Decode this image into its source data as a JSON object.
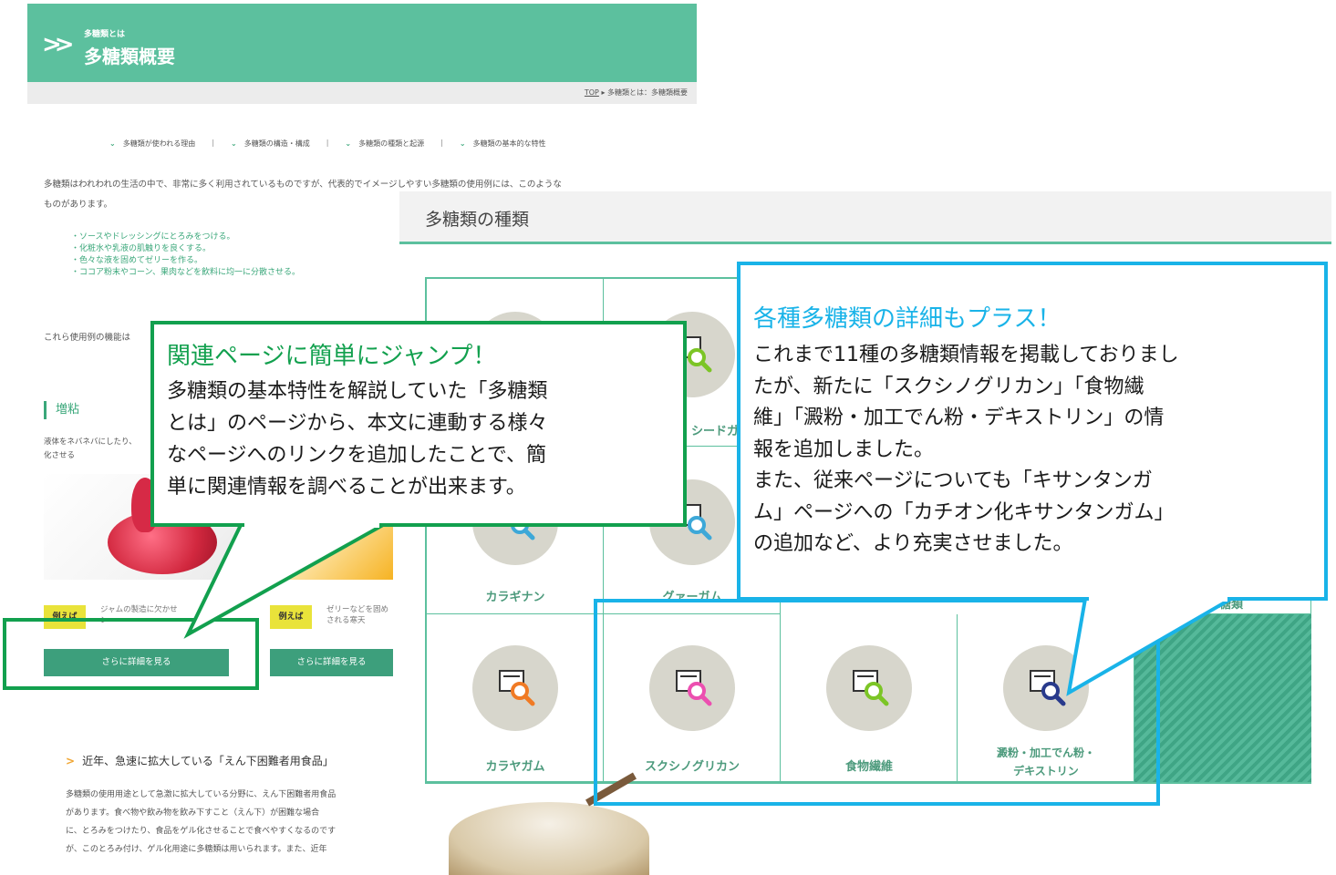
{
  "left_page": {
    "hero": {
      "subtitle": "多糖類とは",
      "title": "多糖類概要"
    },
    "breadcrumb": {
      "top": "TOP",
      "separator": "▸",
      "current": "多糖類とは：多糖類概要"
    },
    "anchors": [
      "多糖類が使われる理由",
      "多糖類の構造・構成",
      "多糖類の種類と起源",
      "多糖類の基本的な特性"
    ],
    "intro_lines": [
      "多糖類はわれわれの生活の中で、非常に多く利用されているものですが、代表的でイメージしやすい多糖類の使用例には、このような",
      "ものがあります。"
    ],
    "uses": [
      "・ソースやドレッシングにとろみをつける。",
      "・化粧水や乳液の肌触りを良くする。",
      "・色々な液を固めてゼリーを作る。",
      "・ココア粉末やコーン、果肉などを飲料に均一に分散させる。"
    ],
    "tail_text": "これら使用例の機能は",
    "section": {
      "heading": "増粘",
      "desc_lines": [
        "液体をネバネバにしたり、",
        "化させる"
      ]
    },
    "examples": [
      {
        "badge": "例えば",
        "text_lines": [
          "ジャムの製造に欠かせ",
          "ン"
        ],
        "button": "さらに詳細を見る"
      },
      {
        "badge": "例えば",
        "text_lines": [
          "ゼリーなどを固め",
          "される寒天"
        ],
        "button": "さらに詳細を見る"
      }
    ],
    "subsection": {
      "heading": "近年、急速に拡大している「えん下困難者用食品」",
      "lines": [
        "多糖類の使用用途として急激に拡大している分野に、えん下困難者用食品",
        "があります。食べ物や飲み物を飲み下すこと（えん下）が困難な場合",
        "に、とろみをつけたり、食品をゲル化させることで食べやすくなるのです",
        "が、このとろみ付け、ゲル化用途に多糖類は用いられます。また、近年"
      ]
    }
  },
  "right_page": {
    "title": "多糖類の種類",
    "row2_labels": [
      "カラギナン",
      "グァーガム"
    ],
    "row2_partial": [
      "シードガ",
      "多糖類"
    ],
    "row3": [
      {
        "label_lines": [
          "カラヤガム"
        ],
        "accent": "#f07a24"
      },
      {
        "label_lines": [
          "スクシノグリカン"
        ],
        "accent": "#ec4fb0"
      },
      {
        "label_lines": [
          "食物繊維"
        ],
        "accent": "#7cc526"
      },
      {
        "label_lines": [
          "澱粉・加工でん粉・",
          "デキストリン"
        ],
        "accent": "#283a8c"
      }
    ],
    "row1_accents": [
      "#7cc526",
      "#3da8d8",
      "#3da8d8"
    ]
  },
  "callouts": {
    "green": {
      "heading": "関連ページに簡単にジャンプ！",
      "lines": [
        "多糖類の基本特性を解説していた「多糖類",
        "とは」のページから、本文に連動する様々",
        "なページへのリンクを追加したことで、簡",
        "単に関連情報を調べることが出来ます。"
      ],
      "color": "#12a04e"
    },
    "blue": {
      "heading": "各種多糖類の詳細もプラス！",
      "lines": [
        "これまで11種の多糖類情報を掲載しておりまし",
        "たが、新たに「スクシノグリカン」「食物繊",
        "維」「澱粉・加工でん粉・デキストリン」の情",
        "報を追加しました。",
        "また、従来ページについても「キサンタンガ",
        "ム」ページへの「カチオン化キサンタンガム」",
        "の追加など、より充実させました。"
      ],
      "color": "#19b3e8"
    }
  },
  "colors": {
    "brand_green": "#5cc09e",
    "button_green": "#3d9f7c",
    "badge_yellow": "#e9e33a"
  }
}
